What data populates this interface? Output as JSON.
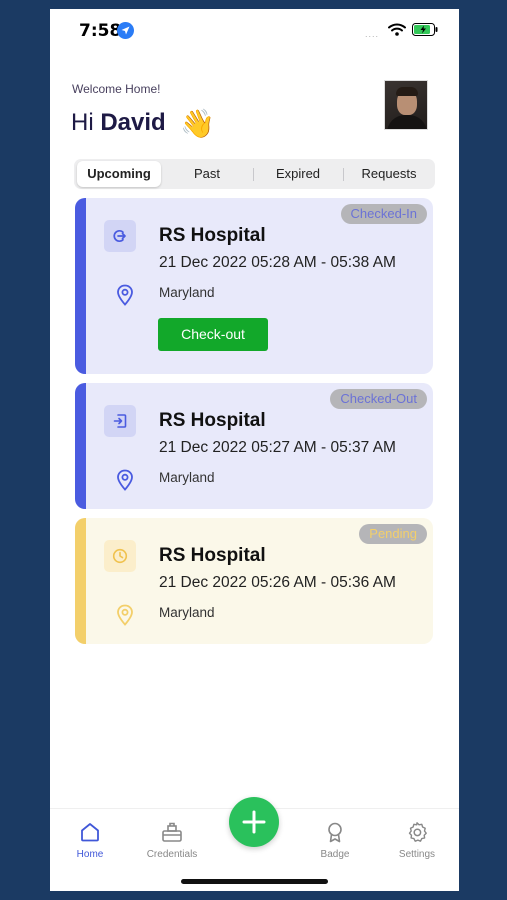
{
  "status_bar": {
    "time": "7:58",
    "signal": "....",
    "location_icon": "location-arrow-icon",
    "wifi_icon": "wifi-icon",
    "battery_icon": "battery-charging-icon"
  },
  "header": {
    "welcome": "Welcome Home!",
    "hi": "Hi ",
    "name": "David",
    "emoji": "👋",
    "avatar_icon": "user-avatar"
  },
  "tabs": [
    {
      "label": "Upcoming",
      "active": true
    },
    {
      "label": "Past",
      "active": false
    },
    {
      "label": "Expired",
      "active": false
    },
    {
      "label": "Requests",
      "active": false
    }
  ],
  "colors": {
    "accent": "#4a5be0",
    "pending": "#f3cf6a",
    "checkout_button": "#12a82a",
    "fab": "#2ac15c",
    "card_blue_bg": "#e8e9fa",
    "card_yellow_bg": "#fbf8e9"
  },
  "visits": [
    {
      "status": "Checked-In",
      "title": "RS Hospital",
      "datetime": "21 Dec 2022 05:28 AM - 05:38 AM",
      "location": "Maryland",
      "action": "Check-out",
      "type_icon": "check-in-icon",
      "pin_icon": "map-pin-icon"
    },
    {
      "status": "Checked-Out",
      "title": "RS Hospital",
      "datetime": "21 Dec 2022 05:27 AM - 05:37 AM",
      "location": "Maryland",
      "type_icon": "check-out-icon",
      "pin_icon": "map-pin-icon"
    },
    {
      "status": "Pending",
      "title": "RS Hospital",
      "datetime": "21 Dec 2022 05:26 AM - 05:36 AM",
      "location": "Maryland",
      "type_icon": "clock-icon",
      "pin_icon": "map-pin-icon"
    }
  ],
  "nav": [
    {
      "label": "Home",
      "icon": "home-icon",
      "active": true
    },
    {
      "label": "Credentials",
      "icon": "credentials-icon",
      "active": false
    },
    {
      "label": "Badge",
      "icon": "badge-icon",
      "active": false
    },
    {
      "label": "Settings",
      "icon": "gear-icon",
      "active": false
    }
  ],
  "fab": {
    "icon": "plus-icon"
  }
}
